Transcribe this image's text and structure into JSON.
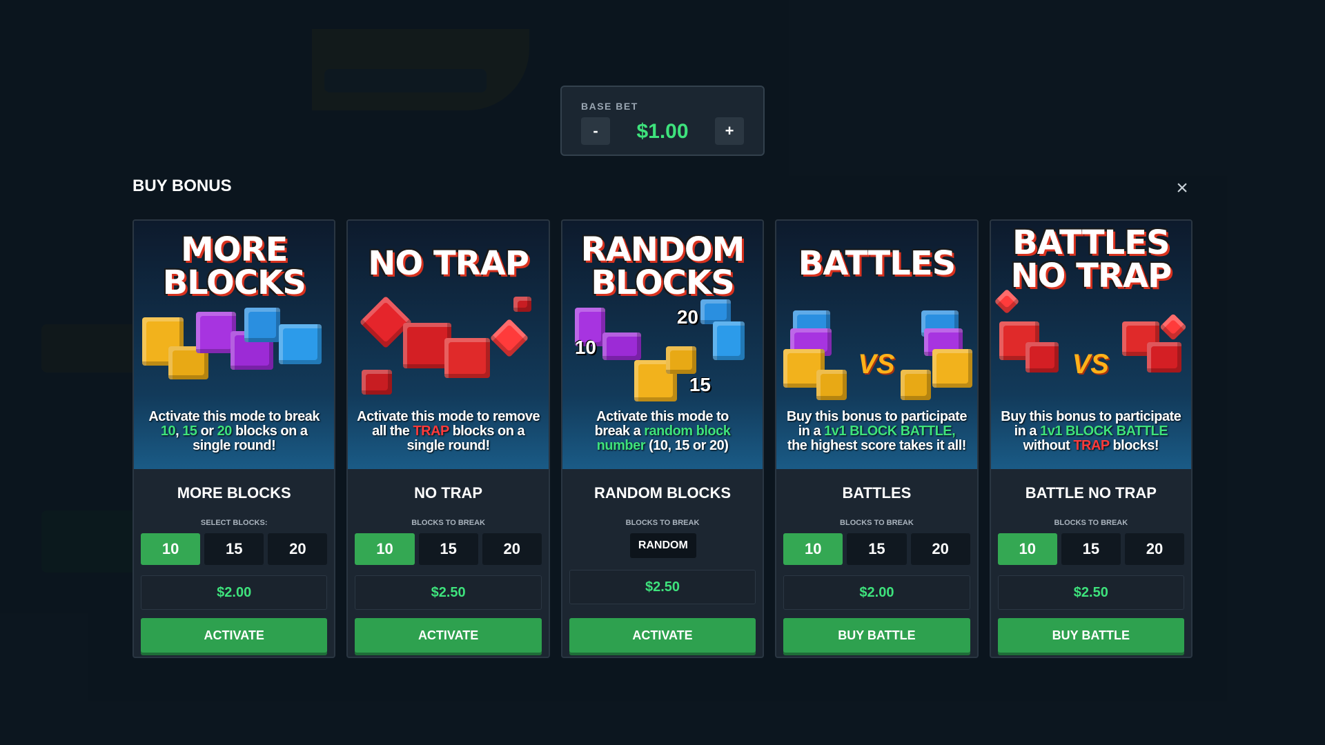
{
  "base_bet": {
    "label": "BASE BET",
    "minus": "-",
    "plus": "+",
    "value": "$1.00"
  },
  "modal": {
    "title": "BUY BONUS",
    "close": "×"
  },
  "cards": [
    {
      "art_title_1": "MORE",
      "art_title_2": "BLOCKS",
      "desc": [
        "Activate this mode to break",
        "10",
        ", ",
        "15",
        " or ",
        "20",
        " blocks on a",
        "single round!"
      ],
      "name": "MORE BLOCKS",
      "sub": "SELECT BLOCKS:",
      "options": [
        "10",
        "15",
        "20"
      ],
      "selected": "10",
      "price": "$2.00",
      "action": "ACTIVATE"
    },
    {
      "art_title_1": "NO TRAP",
      "art_title_2": "",
      "desc": [
        "Activate this mode to remove",
        "all the ",
        "TRAP",
        " blocks on a",
        "single round!"
      ],
      "name": "NO TRAP",
      "sub": "BLOCKS TO BREAK",
      "options": [
        "10",
        "15",
        "20"
      ],
      "selected": "10",
      "price": "$2.50",
      "action": "ACTIVATE"
    },
    {
      "art_title_1": "RANDOM",
      "art_title_2": "BLOCKS",
      "desc": [
        "Activate this mode to",
        "break a ",
        "random block",
        "number",
        " (10, 15 or 20)"
      ],
      "tags": [
        "10",
        "20",
        "15"
      ],
      "name": "RANDOM BLOCKS",
      "sub": "BLOCKS TO BREAK",
      "random_label": "RANDOM",
      "price": "$2.50",
      "action": "ACTIVATE"
    },
    {
      "art_title_1": "BATTLES",
      "art_title_2": "",
      "vs": "VS",
      "desc": [
        "Buy this bonus to participate",
        "in a ",
        "1v1 BLOCK BATTLE,",
        "the highest score takes it all!"
      ],
      "name": "BATTLES",
      "sub": "BLOCKS TO BREAK",
      "options": [
        "10",
        "15",
        "20"
      ],
      "selected": "10",
      "price": "$2.00",
      "action": "BUY BATTLE"
    },
    {
      "art_title_1": "BATTLES",
      "art_title_2": "NO TRAP",
      "vs": "VS",
      "desc": [
        "Buy this bonus to participate",
        "in a ",
        "1v1 BLOCK BATTLE",
        "without ",
        "TRAP",
        " blocks!"
      ],
      "name": "BATTLE NO TRAP",
      "sub": "BLOCKS TO BREAK",
      "options": [
        "10",
        "15",
        "20"
      ],
      "selected": "10",
      "price": "$2.50",
      "action": "BUY BATTLE"
    }
  ],
  "colors": {
    "accent_green": "#3ee27c",
    "button_green": "#2ea14f",
    "trap_red": "#ff3b3b"
  }
}
